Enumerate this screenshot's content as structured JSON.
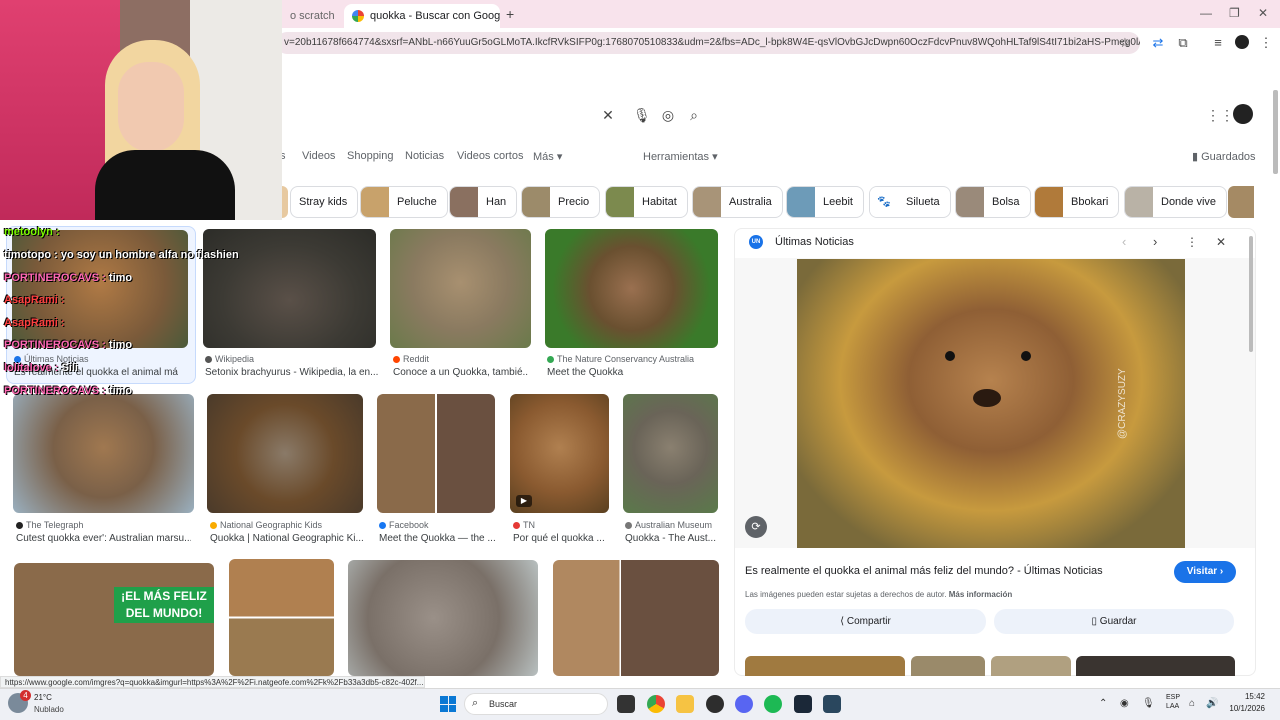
{
  "browser": {
    "tabs": [
      {
        "label": "o scratch",
        "active": false
      },
      {
        "label": "quokka - Buscar con Google",
        "active": true
      }
    ],
    "url": "v=20b11678f664774&sxsrf=ANbL-n66YuuGr5oGLMoTA.IkcfRVkSIFP0g:1768070510833&udm=2&fbs=ADc_l-bpk8W4E-qsVlOvbGJcDwpn60OczFdcvPnuv8WQohHLTaf9lS4tI71bi2aHS-Pmeg0lA2nDWC...",
    "status_url": "https://www.google.com/imgres?q=quokka&imgurl=https%3A%2F%2Fi.natgeofe.com%2Fk%2Fb33a3db5-c82c-402f..."
  },
  "search": {
    "nav_tabs": [
      "s",
      "Videos",
      "Shopping",
      "Noticias",
      "Videos cortos",
      "Más ▾",
      "Herramientas ▾"
    ],
    "saved_label": "Guardados"
  },
  "chips": [
    "Stray kids",
    "Peluche",
    "Han",
    "Precio",
    "Habitat",
    "Australia",
    "Leebit",
    "Silueta",
    "Bolsa",
    "Bbokari",
    "Donde vive"
  ],
  "results": [
    {
      "source": "Últimas Noticias",
      "caption": "Es realmente el quokka el animal má"
    },
    {
      "source": "Wikipedia",
      "caption": "Setonix brachyurus - Wikipedia, la en..."
    },
    {
      "source": "Reddit",
      "caption": "Conoce a un Quokka, tambié..."
    },
    {
      "source": "The Nature Conservancy Australia",
      "caption": "Meet the Quokka"
    },
    {
      "source": "The Telegraph",
      "caption": "Cutest quokka ever': Australian marsu..."
    },
    {
      "source": "National Geographic Kids",
      "caption": "Quokka | National Geographic Ki..."
    },
    {
      "source": "Facebook",
      "caption": "Meet the Quokka — the ..."
    },
    {
      "source": "TN",
      "caption": "Por qué el quokka ..."
    },
    {
      "source": "Australian Museum",
      "caption": "Quokka - The Aust..."
    }
  ],
  "banner_text": "¡EL MÁS FELIZ DEL MUNDO!",
  "panel": {
    "source": "Últimas Noticias",
    "source_badge": "UN",
    "watermark": "@CRAZYSUZY",
    "title": "Es realmente el quokka el animal más feliz del mundo? - Últimas Noticias",
    "visit_label": "Visitar ›",
    "copyright": "Las imágenes pueden estar sujetas a derechos de autor.",
    "more_info": "Más información",
    "share_label": "Compartir",
    "save_label": "Guardar"
  },
  "chat": [
    {
      "user": "metoolyn :",
      "msg": "",
      "color": "#7CFC00"
    },
    {
      "user": "timotopo :",
      "msg": "yo soy un hombre alfa no flashien",
      "color": "#ffffff"
    },
    {
      "user": "PORTINEROCAVS :",
      "msg": "timo",
      "color": "#ff69b4"
    },
    {
      "user": "AsapRami :",
      "msg": "",
      "color": "#ff4040"
    },
    {
      "user": "AsapRami :",
      "msg": "",
      "color": "#ff4040"
    },
    {
      "user": "PORTINEROCAVS :",
      "msg": "timo",
      "color": "#ff69b4"
    },
    {
      "user": "lolitalove :",
      "msg": "Sili",
      "color": "#ff69b4"
    },
    {
      "user": "PORTINEROCAVS :",
      "msg": "timo",
      "color": "#ff69b4"
    }
  ],
  "taskbar": {
    "weather_temp": "21°C",
    "weather_desc": "Nublado",
    "notification_count": "4",
    "search_placeholder": "Buscar",
    "lang_line1": "ESP",
    "lang_line2": "LAA",
    "time": "15:42",
    "date": "10/1/2026"
  }
}
